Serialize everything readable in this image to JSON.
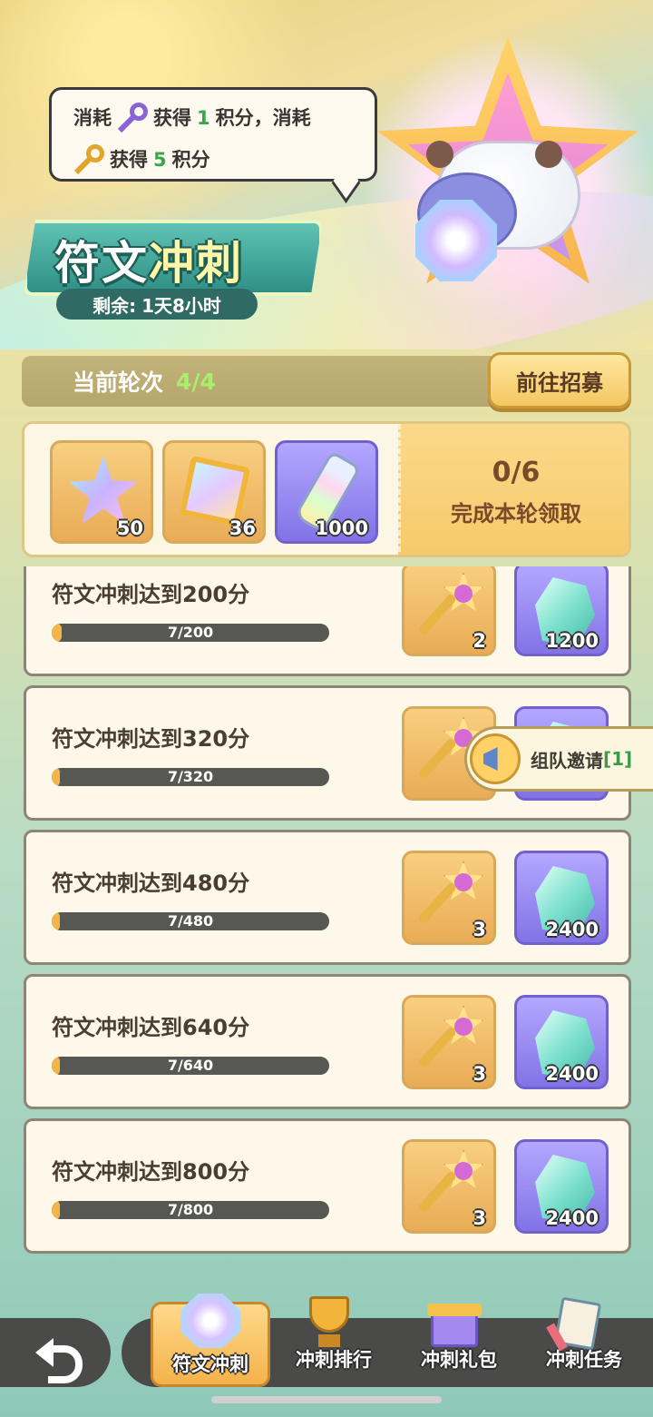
{
  "header": {
    "tip": {
      "line1_prefix": "消耗",
      "line1_middle": "获得",
      "line1_points": "1",
      "line1_suffix": "积分，消耗",
      "line2_prefix": "获得",
      "line2_points": "5",
      "line2_suffix": "积分"
    },
    "title_part1": "符文",
    "title_part2": "冲刺",
    "remain_label": "剩余:",
    "remain_value": "1天8小时"
  },
  "round": {
    "label": "当前轮次",
    "value": "4/4",
    "recruit_button": "前往招募"
  },
  "round_rewards": {
    "items": [
      {
        "icon": "rainbow-star-icon",
        "count": "50"
      },
      {
        "icon": "rainbow-cube-icon",
        "count": "36"
      },
      {
        "icon": "rainbow-bottle-icon",
        "count": "1000"
      }
    ],
    "progress": "0/6",
    "claim_text": "完成本轮领取"
  },
  "tasks": [
    {
      "label": "符文冲刺达到200分",
      "progress_text": "7/200",
      "progress": 0.035,
      "key_count": "2",
      "crystal_count": "1200"
    },
    {
      "label": "符文冲刺达到320分",
      "progress_text": "7/320",
      "progress": 0.022,
      "key_count": "",
      "crystal_count": ""
    },
    {
      "label": "符文冲刺达到480分",
      "progress_text": "7/480",
      "progress": 0.015,
      "key_count": "3",
      "crystal_count": "2400"
    },
    {
      "label": "符文冲刺达到640分",
      "progress_text": "7/640",
      "progress": 0.011,
      "key_count": "3",
      "crystal_count": "2400"
    },
    {
      "label": "符文冲刺达到800分",
      "progress_text": "7/800",
      "progress": 0.009,
      "key_count": "3",
      "crystal_count": "2400"
    }
  ],
  "invite": {
    "label": "组队邀请",
    "count": "[1]"
  },
  "nav": {
    "tabs": [
      {
        "label": "符文冲刺",
        "icon": "gem-icon",
        "active": true
      },
      {
        "label": "冲刺排行",
        "icon": "trophy-icon"
      },
      {
        "label": "冲刺礼包",
        "icon": "gift-icon"
      },
      {
        "label": "冲刺任务",
        "icon": "clipboard-icon"
      }
    ]
  },
  "colors": {
    "accent_green": "#3aa64c",
    "round_green": "#a7f06c",
    "progress_fill": "#f3b646",
    "title_teal": "#2f8f86"
  }
}
